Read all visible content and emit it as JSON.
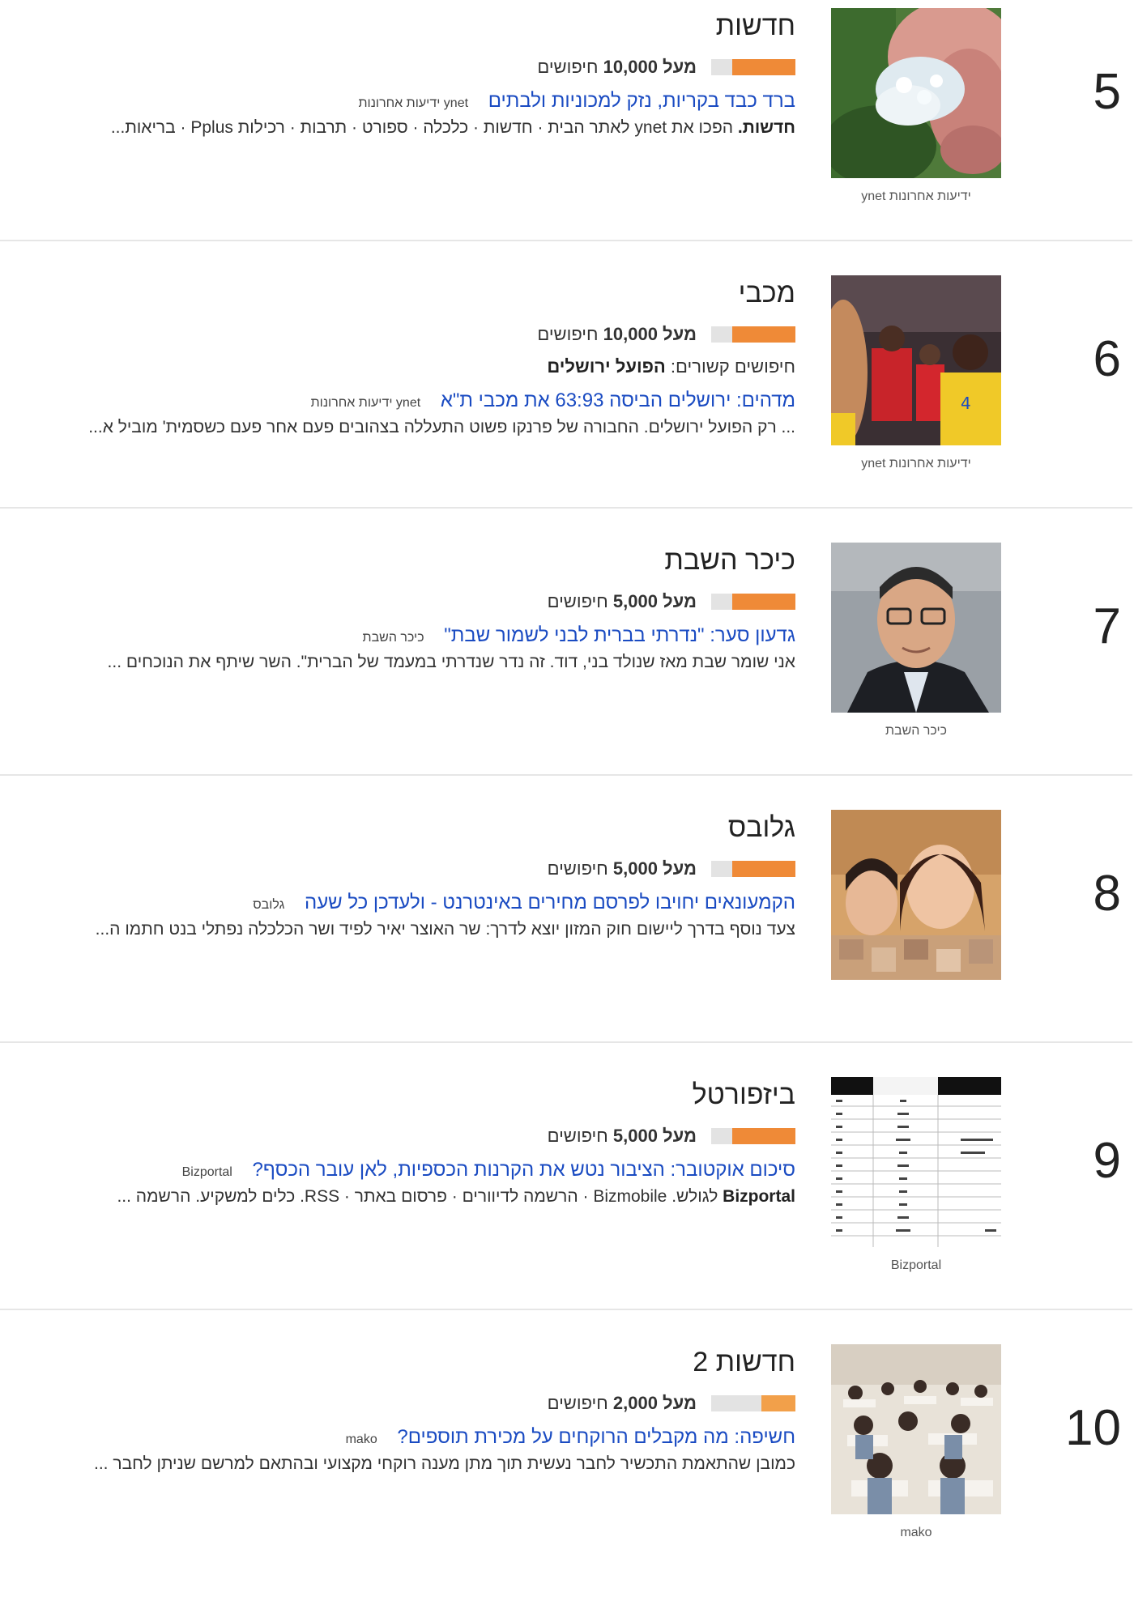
{
  "rows": [
    {
      "rank": "5",
      "title": "חדשות",
      "searches_prefix": "מעל 10,000",
      "searches_suffix": "חיפושים",
      "bar_fill": 0.75,
      "bar_color": "#ef8a37",
      "news_link": "ברד כבד בקריות, נזק למכוניות ולבתים",
      "news_source": "ynet ידיעות אחרונות",
      "snippet_bold": "חדשות.",
      "snippet": " הפכו את ynet לאתר הבית · חדשות · כלכלה · ספורט · תרבות · רכילות Pplus · בריאות...",
      "thumb_caption": "ynet ידיעות אחרונות",
      "thumb_icon": "hail-ice-photo"
    },
    {
      "rank": "6",
      "title": "מכבי",
      "searches_prefix": "מעל 10,000",
      "searches_suffix": "חיפושים",
      "bar_fill": 0.75,
      "bar_color": "#ef8a37",
      "related_label": "חיפושים קשורים:",
      "related_value": "הפועל ירושלים",
      "news_link": "מדהים: ירושלים הביסה 63:93 את מכבי ת\"א",
      "news_source": "ynet ידיעות אחרונות",
      "snippet": "... רק הפועל ירושלים. החבורה של פרנקו פשוט התעללה בצהובים פעם אחר פעם כשסמית' מוביל א...",
      "thumb_caption": "ynet ידיעות אחרונות",
      "thumb_icon": "basketball-photo"
    },
    {
      "rank": "7",
      "title": "כיכר השבת",
      "searches_prefix": "מעל 5,000",
      "searches_suffix": "חיפושים",
      "bar_fill": 0.75,
      "bar_color": "#ef8a37",
      "news_link": "גדעון סער: \"נדרתי בברית לבני לשמור שבת\"",
      "news_source": "כיכר השבת",
      "snippet": "אני שומר שבת מאז שנולד בני, דוד. זה נדר שנדרתי במעמד של הברית\". השר שיתף את הנוכחים ...",
      "thumb_caption": "כיכר השבת",
      "thumb_icon": "politician-photo"
    },
    {
      "rank": "8",
      "title": "גלובס",
      "searches_prefix": "מעל 5,000",
      "searches_suffix": "חיפושים",
      "bar_fill": 0.75,
      "bar_color": "#ef8a37",
      "news_link": "הקמעונאים יחויבו לפרסם מחירים באינטרנט - ולעדכן כל שעה",
      "news_source": "גלובס",
      "snippet": "צעד נוסף בדרך ליישום חוק המזון יוצא לדרך: שר האוצר יאיר לפיד ושר הכלכלה נפתלי בנט חתמו ה...",
      "thumb_caption": "",
      "thumb_icon": "women-photo"
    },
    {
      "rank": "9",
      "title": "ביזפורטל",
      "searches_prefix": "מעל 5,000",
      "searches_suffix": "חיפושים",
      "bar_fill": 0.75,
      "bar_color": "#ef8a37",
      "news_link": "סיכום אוקטובר: הציבור נטש את הקרנות הכספיות, לאן עובר הכסף?",
      "news_source": "Bizportal",
      "snippet_bold": "Bizportal",
      "snippet": " לגולש. Bizmobile · הרשמה לדיוורים · פרסום באתר · RSS. כלים למשקיע. הרשמה ...",
      "thumb_caption": "Bizportal",
      "thumb_icon": "table-photo"
    },
    {
      "rank": "10",
      "title": "חדשות 2",
      "searches_prefix": "מעל 2,000",
      "searches_suffix": "חיפושים",
      "bar_fill": 0.4,
      "bar_color": "#f2a04a",
      "news_link": "חשיפה: מה מקבלים הרוקחים על מכירת תוספים?",
      "news_source": "mako",
      "snippet": "כמובן שהתאמת התכשיר לחבר נעשית תוך מתן מענה רוקחי מקצועי ובהתאם למרשם שניתן לחבר ...",
      "thumb_caption": "mako",
      "thumb_icon": "classroom-photo"
    }
  ]
}
